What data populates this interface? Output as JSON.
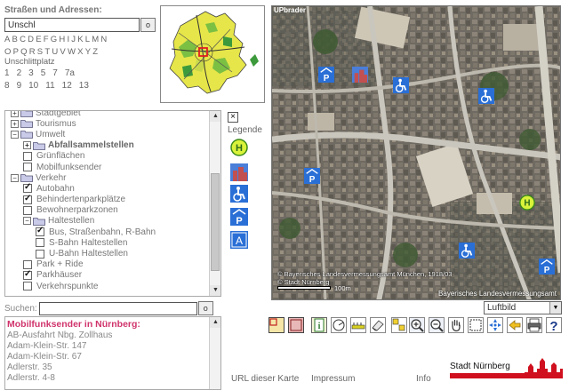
{
  "street_search": {
    "title": "Straßen und Adressen:",
    "input_value": "Unschl",
    "go_label": "o",
    "letters_row1": [
      "A",
      "B",
      "C",
      "D",
      "E",
      "F",
      "G",
      "H",
      "I",
      "J",
      "K",
      "L",
      "M",
      "N"
    ],
    "letters_row2": [
      "O",
      "P",
      "Q",
      "R",
      "S",
      "T",
      "U",
      "V",
      "W",
      "X",
      "Y",
      "Z"
    ],
    "street_name": "Unschlittplatz",
    "house_numbers_row1": [
      "1",
      "2",
      "3",
      "5",
      "7",
      "7a"
    ],
    "house_numbers_row2": [
      "8",
      "9",
      "10",
      "11",
      "12",
      "13"
    ]
  },
  "layer_tree": {
    "items": [
      {
        "label": "Stadtgebiet",
        "level": 0,
        "type": "folder",
        "expander": "+",
        "bold": false
      },
      {
        "label": "Tourismus",
        "level": 0,
        "type": "folder",
        "expander": "+",
        "bold": false
      },
      {
        "label": "Umwelt",
        "level": 0,
        "type": "folder",
        "expander": "−",
        "bold": false
      },
      {
        "label": "Abfallsammelstellen",
        "level": 1,
        "type": "folder",
        "expander": "+",
        "bold": true
      },
      {
        "label": "Grünflächen",
        "level": 1,
        "type": "check",
        "checked": false
      },
      {
        "label": "Mobilfunksender",
        "level": 1,
        "type": "check",
        "checked": false
      },
      {
        "label": "Verkehr",
        "level": 0,
        "type": "folder",
        "expander": "−",
        "bold": false
      },
      {
        "label": "Autobahn",
        "level": 1,
        "type": "check",
        "checked": true
      },
      {
        "label": "Behindertenparkplätze",
        "level": 1,
        "type": "check",
        "checked": true
      },
      {
        "label": "Bewohnerparkzonen",
        "level": 1,
        "type": "check",
        "checked": false
      },
      {
        "label": "Haltestellen",
        "level": 1,
        "type": "folder",
        "expander": "−",
        "bold": false
      },
      {
        "label": "Bus, Straßenbahn, R-Bahn",
        "level": 2,
        "type": "check",
        "checked": true
      },
      {
        "label": "S-Bahn Haltestellen",
        "level": 2,
        "type": "check",
        "checked": false
      },
      {
        "label": "U-Bahn Haltestellen",
        "level": 2,
        "type": "check",
        "checked": false
      },
      {
        "label": "Park + Ride",
        "level": 1,
        "type": "check",
        "checked": false
      },
      {
        "label": "Parkhäuser",
        "level": 1,
        "type": "check",
        "checked": true
      },
      {
        "label": "Verkehrspunkte",
        "level": 1,
        "type": "check",
        "checked": false
      }
    ]
  },
  "legend": {
    "close_label": "×",
    "title": "Legende",
    "icons": [
      "bus-stop-icon",
      "building-icon",
      "wheelchair-icon",
      "parking-garage-icon",
      "autobahn-icon"
    ]
  },
  "search": {
    "label": "Suchen:",
    "input_value": "",
    "go_label": "o"
  },
  "results": {
    "title": "Mobilfunksender in Nürnberg:",
    "items": [
      "AB-Ausfahrt Nbg. Zollhaus",
      "Adam-Klein-Str. 147",
      "Adam-Klein-Str. 67",
      "Adlerstr. 35",
      "Adlerstr. 4-8"
    ]
  },
  "map": {
    "brand": "UPbrader",
    "copyright_line1": "© Bayerisches Landesvermessungsamt München, 1918/03",
    "copyright_line2": "© Stadt Nürnberg",
    "scale_label": "100m",
    "credit": "Bayerisches Landesvermessungsamt"
  },
  "layer_select": {
    "selected": "Luftbild",
    "arrow": "▼"
  },
  "toolbar": {
    "tools": [
      "map-view-icon",
      "overview-toggle-icon",
      "info-icon",
      "measure-icon",
      "scale-icon",
      "eraser-icon",
      "print-area-icon",
      "zoom-in-icon",
      "zoom-out-icon",
      "pan-hand-icon",
      "zoom-box-icon",
      "center-icon",
      "back-arrow-icon",
      "print-icon",
      "help-icon"
    ]
  },
  "footer": {
    "url_link": "URL dieser Karte",
    "impressum_link": "Impressum",
    "info_link": "Info",
    "city_name": "Stadt Nürnberg"
  },
  "colors": {
    "results_title": "#d0336b",
    "logo_red": "#d0101e",
    "map_blue_icon": "#2a6fd6"
  }
}
